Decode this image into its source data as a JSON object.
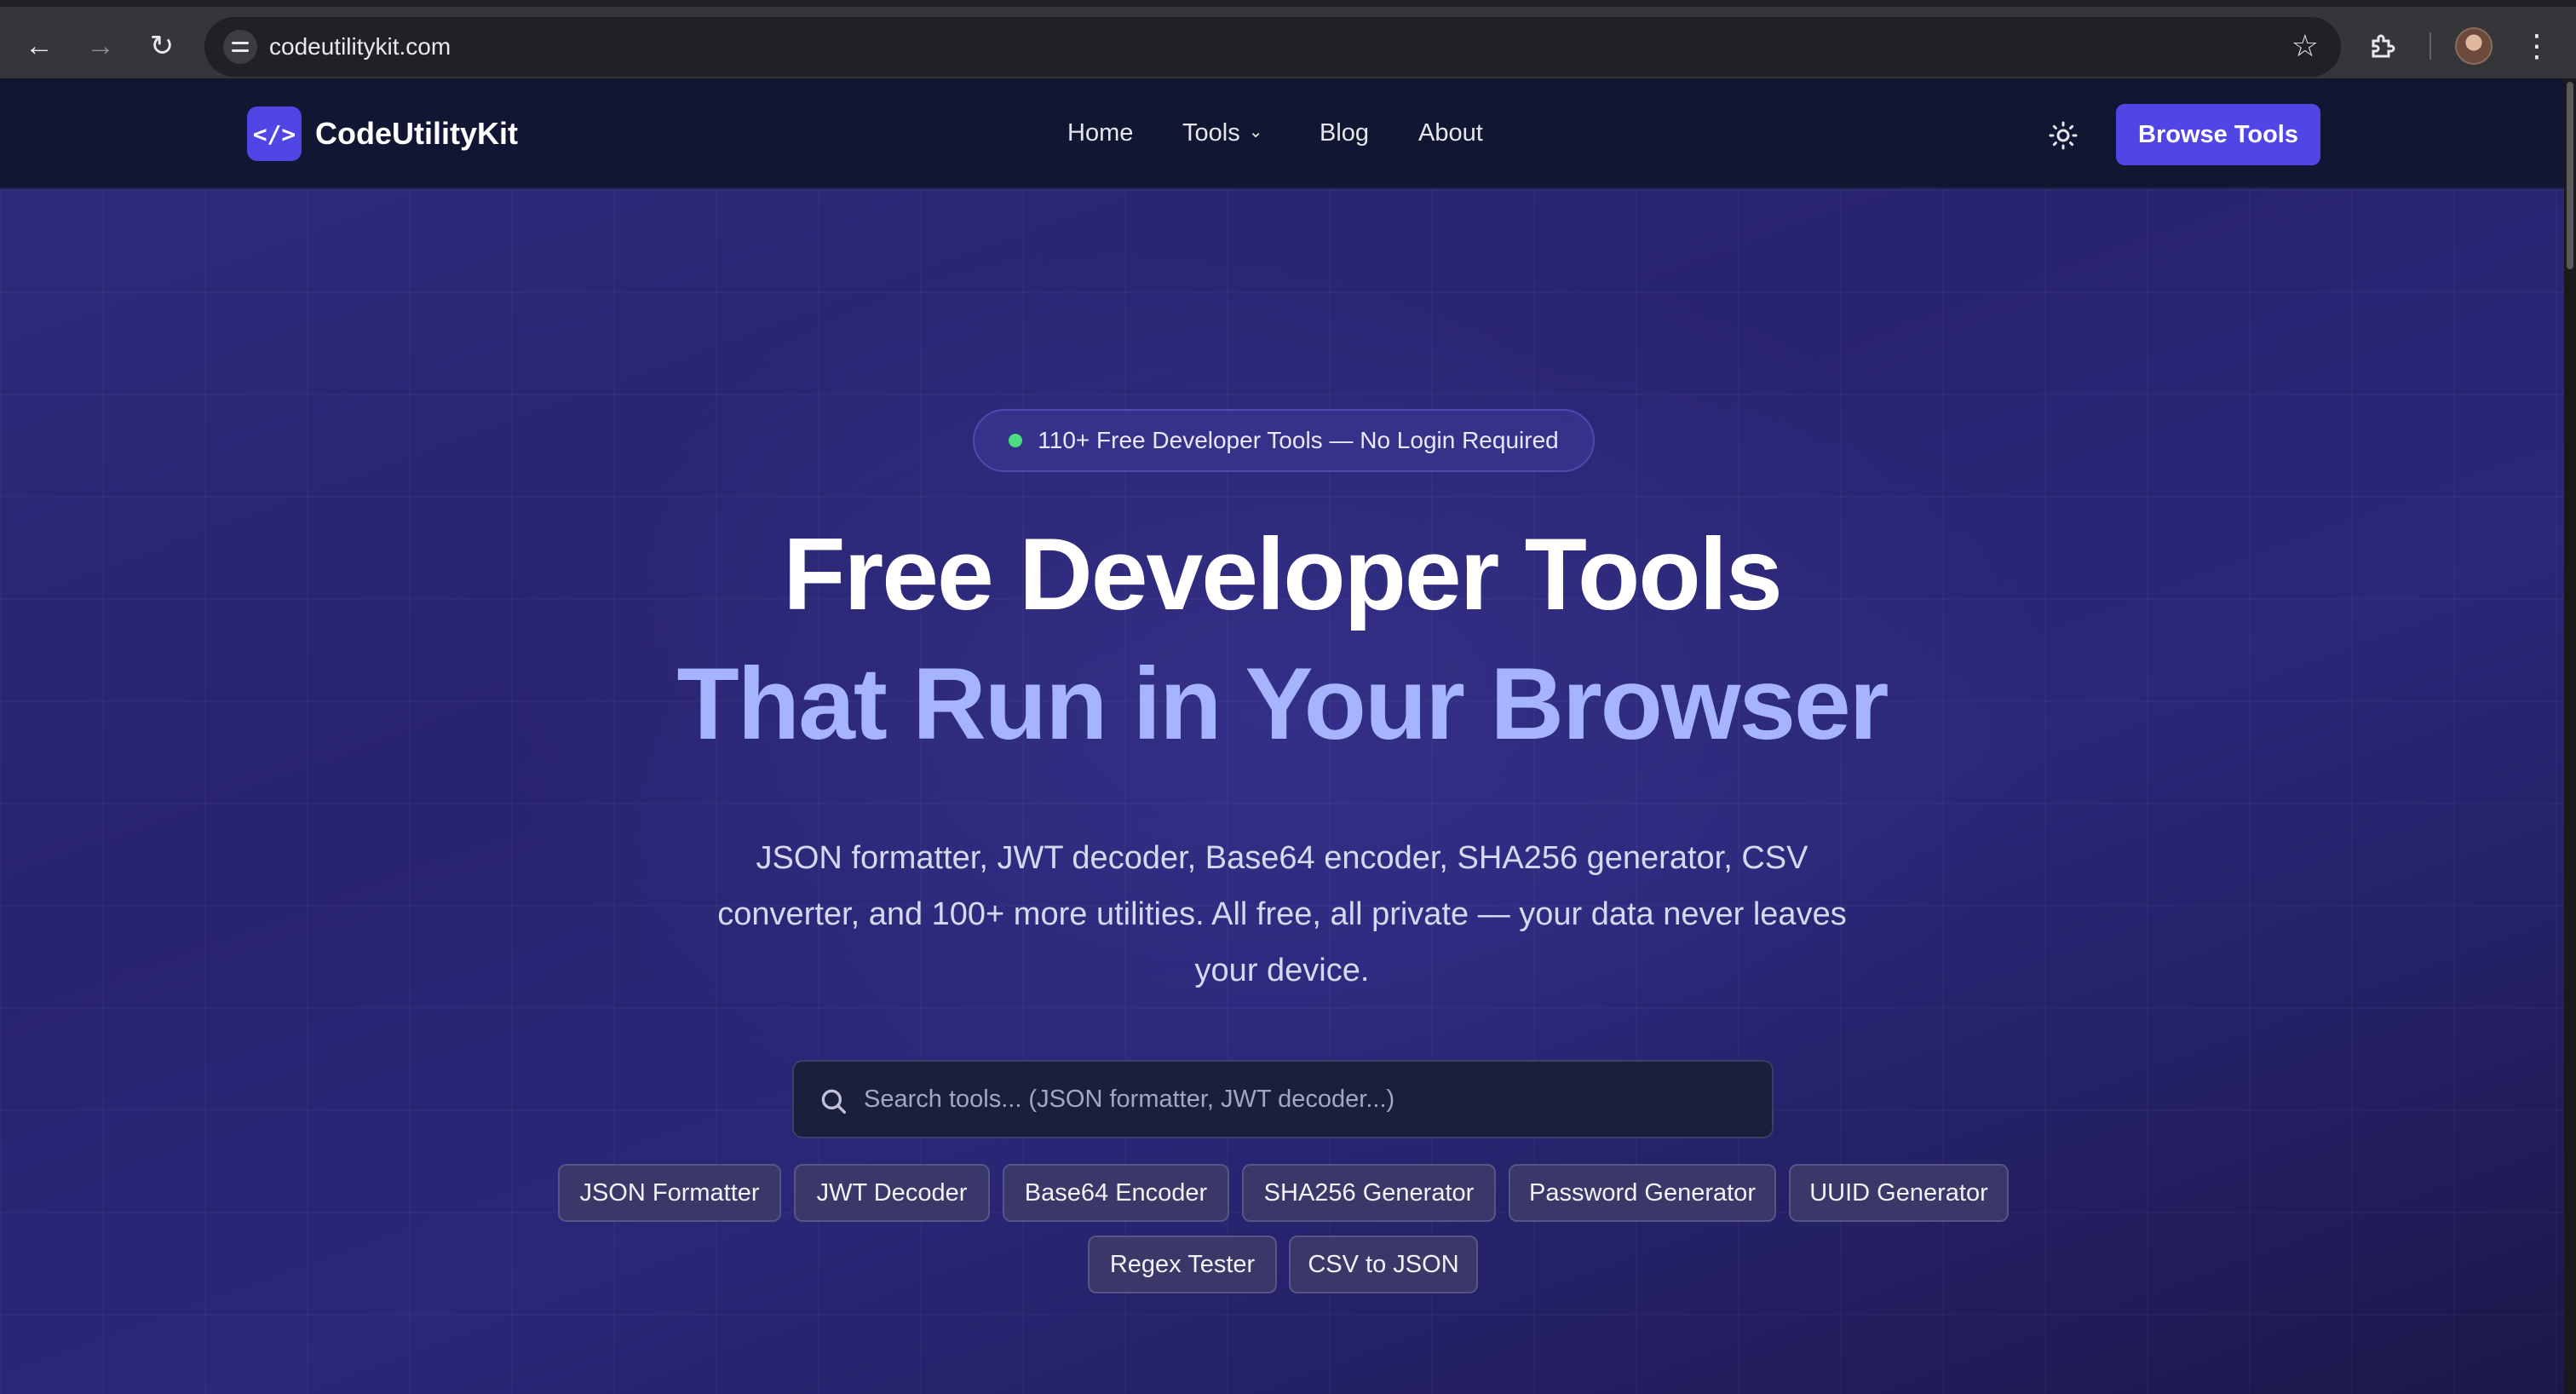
{
  "browser": {
    "url": "codeutilitykit.com",
    "icons": {
      "back": "arrow-left-icon",
      "forward": "arrow-right-icon",
      "reload": "reload-icon",
      "site_info": "tune-icon",
      "bookmark": "star-icon",
      "extensions": "puzzle-icon",
      "menu": "kebab-menu-icon"
    }
  },
  "header": {
    "logo_glyph": "</>",
    "brand": "CodeUtilityKit",
    "nav": {
      "home": "Home",
      "tools": "Tools",
      "blog": "Blog",
      "about": "About"
    },
    "cta": "Browse Tools"
  },
  "hero": {
    "badge": "110+ Free Developer Tools — No Login Required",
    "title_line1": "Free Developer Tools",
    "title_line2": "That Run in Your Browser",
    "subtitle": "JSON formatter, JWT decoder, Base64 encoder, SHA256 generator, CSV converter, and 100+ more utilities. All free, all private — your data never leaves your device.",
    "search_placeholder": "Search tools... (JSON formatter, JWT decoder...)",
    "chips": [
      "JSON Formatter",
      "JWT Decoder",
      "Base64 Encoder",
      "SHA256 Generator",
      "Password Generator",
      "UUID Generator",
      "Regex Tester",
      "CSV to JSON"
    ]
  },
  "colors": {
    "accent": "#4f46e5",
    "header_bg": "#111632",
    "hero_bg": "#2a2676",
    "title_highlight": "#a5b4fc",
    "status_dot": "#4ade80"
  }
}
